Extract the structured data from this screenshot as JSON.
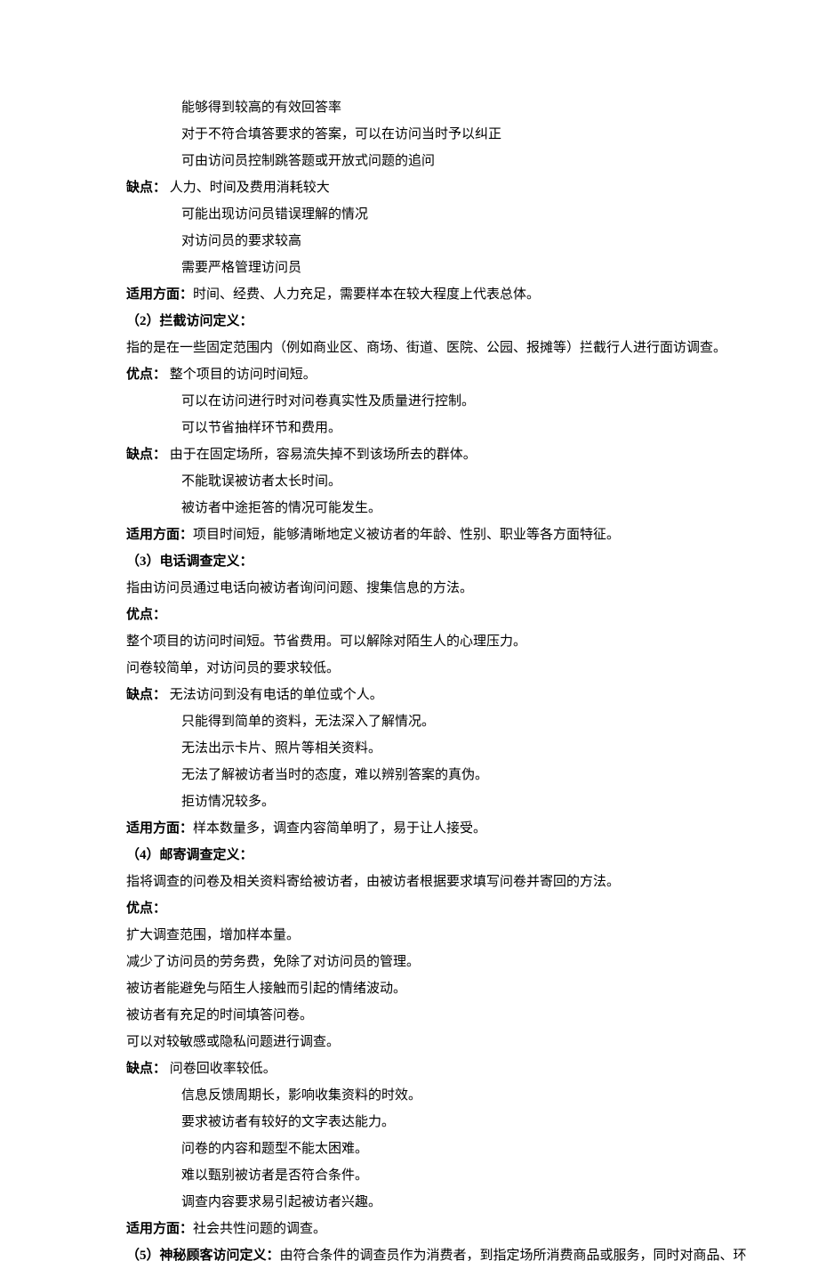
{
  "lines": [
    {
      "indent": true,
      "spans": [
        {
          "t": "能够得到较高的有效回答率"
        }
      ]
    },
    {
      "indent": true,
      "spans": [
        {
          "t": "对于不符合填答要求的答案，可以在访问当时予以纠正"
        }
      ]
    },
    {
      "indent": true,
      "spans": [
        {
          "t": "可由访问员控制跳答题或开放式问题的追问"
        }
      ]
    },
    {
      "spans": [
        {
          "t": "缺点：",
          "b": true
        },
        {
          "t": "  人力、时间及费用消耗较大"
        }
      ]
    },
    {
      "indent": true,
      "spans": [
        {
          "t": "可能出现访问员错误理解的情况"
        }
      ]
    },
    {
      "indent": true,
      "spans": [
        {
          "t": "对访问员的要求较高"
        }
      ]
    },
    {
      "indent": true,
      "spans": [
        {
          "t": "需要严格管理访问员"
        }
      ]
    },
    {
      "spans": [
        {
          "t": "适用方面：",
          "b": true
        },
        {
          "t": "时间、经费、人力充足，需要样本在较大程度上代表总体。"
        }
      ]
    },
    {
      "spans": [
        {
          "t": "（2）拦截访问定义：",
          "b": true
        }
      ]
    },
    {
      "spans": [
        {
          "t": "指的是在一些固定范围内（例如商业区、商场、街道、医院、公园、报摊等）拦截行人进行面访调查。"
        }
      ]
    },
    {
      "spans": [
        {
          "t": "优点：",
          "b": true
        },
        {
          "t": "  整个项目的访问时间短。"
        }
      ]
    },
    {
      "indent": true,
      "spans": [
        {
          "t": "可以在访问进行时对问卷真实性及质量进行控制。"
        }
      ]
    },
    {
      "indent": true,
      "spans": [
        {
          "t": "可以节省抽样环节和费用。"
        }
      ]
    },
    {
      "spans": [
        {
          "t": "缺点：",
          "b": true
        },
        {
          "t": "  由于在固定场所，容易流失掉不到该场所去的群体。"
        }
      ]
    },
    {
      "indent": true,
      "spans": [
        {
          "t": "不能耽误被访者太长时间。"
        }
      ]
    },
    {
      "indent": true,
      "spans": [
        {
          "t": "被访者中途拒答的情况可能发生。"
        }
      ]
    },
    {
      "spans": [
        {
          "t": "适用方面：",
          "b": true
        },
        {
          "t": "项目时间短，能够清晰地定义被访者的年龄、性别、职业等各方面特征。"
        }
      ]
    },
    {
      "spans": [
        {
          "t": "（3）电话调查定义：",
          "b": true
        }
      ]
    },
    {
      "spans": [
        {
          "t": "指由访问员通过电话向被访者询问问题、搜集信息的方法。"
        }
      ]
    },
    {
      "spans": [
        {
          "t": "优点：",
          "b": true
        }
      ]
    },
    {
      "spans": [
        {
          "t": "整个项目的访问时间短。节省费用。可以解除对陌生人的心理压力。"
        }
      ]
    },
    {
      "spans": [
        {
          "t": "问卷较简单，对访问员的要求较低。"
        }
      ]
    },
    {
      "spans": [
        {
          "t": "缺点：",
          "b": true
        },
        {
          "t": "  无法访问到没有电话的单位或个人。"
        }
      ]
    },
    {
      "indent": true,
      "spans": [
        {
          "t": "只能得到简单的资料，无法深入了解情况。"
        }
      ]
    },
    {
      "indent": true,
      "spans": [
        {
          "t": "无法出示卡片、照片等相关资料。"
        }
      ]
    },
    {
      "indent": true,
      "spans": [
        {
          "t": "无法了解被访者当时的态度，难以辨别答案的真伪。"
        }
      ]
    },
    {
      "indent": true,
      "spans": [
        {
          "t": "拒访情况较多。"
        }
      ]
    },
    {
      "spans": [
        {
          "t": "适用方面：",
          "b": true
        },
        {
          "t": "样本数量多，调查内容简单明了，易于让人接受。"
        }
      ]
    },
    {
      "spans": [
        {
          "t": "（4）邮寄调查定义：",
          "b": true
        }
      ]
    },
    {
      "spans": [
        {
          "t": "指将调查的问卷及相关资料寄给被访者，由被访者根据要求填写问卷并寄回的方法。"
        }
      ]
    },
    {
      "spans": [
        {
          "t": "优点：",
          "b": true
        }
      ]
    },
    {
      "spans": [
        {
          "t": "扩大调查范围，增加样本量。"
        }
      ]
    },
    {
      "spans": [
        {
          "t": "减少了访问员的劳务费，免除了对访问员的管理。"
        }
      ]
    },
    {
      "spans": [
        {
          "t": "被访者能避免与陌生人接触而引起的情绪波动。"
        }
      ]
    },
    {
      "spans": [
        {
          "t": "被访者有充足的时间填答问卷。"
        }
      ]
    },
    {
      "spans": [
        {
          "t": "可以对较敏感或隐私问题进行调查。"
        }
      ]
    },
    {
      "spans": [
        {
          "t": "缺点：",
          "b": true
        },
        {
          "t": "  问卷回收率较低。"
        }
      ]
    },
    {
      "indent": true,
      "spans": [
        {
          "t": "信息反馈周期长，影响收集资料的时效。"
        }
      ]
    },
    {
      "indent": true,
      "spans": [
        {
          "t": "要求被访者有较好的文字表达能力。"
        }
      ]
    },
    {
      "indent": true,
      "spans": [
        {
          "t": "问卷的内容和题型不能太困难。"
        }
      ]
    },
    {
      "indent": true,
      "spans": [
        {
          "t": "难以甄别被访者是否符合条件。"
        }
      ]
    },
    {
      "indent": true,
      "spans": [
        {
          "t": "调查内容要求易引起被访者兴趣。"
        }
      ]
    },
    {
      "spans": [
        {
          "t": "适用方面：",
          "b": true
        },
        {
          "t": "社会共性问题的调查。"
        }
      ]
    },
    {
      "spans": [
        {
          "t": "（5）神秘顾客访问定义：",
          "b": true
        },
        {
          "t": "由符合条件的调查员作为消费者，到指定场所消费商品或服务，同时对商品、环"
        }
      ]
    }
  ]
}
